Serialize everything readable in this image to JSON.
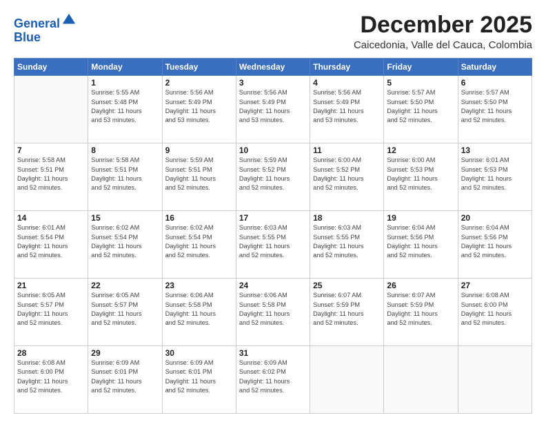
{
  "header": {
    "logo_line1": "General",
    "logo_line2": "Blue",
    "month_title": "December 2025",
    "location": "Caicedonia, Valle del Cauca, Colombia"
  },
  "weekdays": [
    "Sunday",
    "Monday",
    "Tuesday",
    "Wednesday",
    "Thursday",
    "Friday",
    "Saturday"
  ],
  "weeks": [
    [
      {
        "day": "",
        "info": ""
      },
      {
        "day": "1",
        "info": "Sunrise: 5:55 AM\nSunset: 5:48 PM\nDaylight: 11 hours\nand 53 minutes."
      },
      {
        "day": "2",
        "info": "Sunrise: 5:56 AM\nSunset: 5:49 PM\nDaylight: 11 hours\nand 53 minutes."
      },
      {
        "day": "3",
        "info": "Sunrise: 5:56 AM\nSunset: 5:49 PM\nDaylight: 11 hours\nand 53 minutes."
      },
      {
        "day": "4",
        "info": "Sunrise: 5:56 AM\nSunset: 5:49 PM\nDaylight: 11 hours\nand 53 minutes."
      },
      {
        "day": "5",
        "info": "Sunrise: 5:57 AM\nSunset: 5:50 PM\nDaylight: 11 hours\nand 52 minutes."
      },
      {
        "day": "6",
        "info": "Sunrise: 5:57 AM\nSunset: 5:50 PM\nDaylight: 11 hours\nand 52 minutes."
      }
    ],
    [
      {
        "day": "7",
        "info": "Sunrise: 5:58 AM\nSunset: 5:51 PM\nDaylight: 11 hours\nand 52 minutes."
      },
      {
        "day": "8",
        "info": "Sunrise: 5:58 AM\nSunset: 5:51 PM\nDaylight: 11 hours\nand 52 minutes."
      },
      {
        "day": "9",
        "info": "Sunrise: 5:59 AM\nSunset: 5:51 PM\nDaylight: 11 hours\nand 52 minutes."
      },
      {
        "day": "10",
        "info": "Sunrise: 5:59 AM\nSunset: 5:52 PM\nDaylight: 11 hours\nand 52 minutes."
      },
      {
        "day": "11",
        "info": "Sunrise: 6:00 AM\nSunset: 5:52 PM\nDaylight: 11 hours\nand 52 minutes."
      },
      {
        "day": "12",
        "info": "Sunrise: 6:00 AM\nSunset: 5:53 PM\nDaylight: 11 hours\nand 52 minutes."
      },
      {
        "day": "13",
        "info": "Sunrise: 6:01 AM\nSunset: 5:53 PM\nDaylight: 11 hours\nand 52 minutes."
      }
    ],
    [
      {
        "day": "14",
        "info": "Sunrise: 6:01 AM\nSunset: 5:54 PM\nDaylight: 11 hours\nand 52 minutes."
      },
      {
        "day": "15",
        "info": "Sunrise: 6:02 AM\nSunset: 5:54 PM\nDaylight: 11 hours\nand 52 minutes."
      },
      {
        "day": "16",
        "info": "Sunrise: 6:02 AM\nSunset: 5:54 PM\nDaylight: 11 hours\nand 52 minutes."
      },
      {
        "day": "17",
        "info": "Sunrise: 6:03 AM\nSunset: 5:55 PM\nDaylight: 11 hours\nand 52 minutes."
      },
      {
        "day": "18",
        "info": "Sunrise: 6:03 AM\nSunset: 5:55 PM\nDaylight: 11 hours\nand 52 minutes."
      },
      {
        "day": "19",
        "info": "Sunrise: 6:04 AM\nSunset: 5:56 PM\nDaylight: 11 hours\nand 52 minutes."
      },
      {
        "day": "20",
        "info": "Sunrise: 6:04 AM\nSunset: 5:56 PM\nDaylight: 11 hours\nand 52 minutes."
      }
    ],
    [
      {
        "day": "21",
        "info": "Sunrise: 6:05 AM\nSunset: 5:57 PM\nDaylight: 11 hours\nand 52 minutes."
      },
      {
        "day": "22",
        "info": "Sunrise: 6:05 AM\nSunset: 5:57 PM\nDaylight: 11 hours\nand 52 minutes."
      },
      {
        "day": "23",
        "info": "Sunrise: 6:06 AM\nSunset: 5:58 PM\nDaylight: 11 hours\nand 52 minutes."
      },
      {
        "day": "24",
        "info": "Sunrise: 6:06 AM\nSunset: 5:58 PM\nDaylight: 11 hours\nand 52 minutes."
      },
      {
        "day": "25",
        "info": "Sunrise: 6:07 AM\nSunset: 5:59 PM\nDaylight: 11 hours\nand 52 minutes."
      },
      {
        "day": "26",
        "info": "Sunrise: 6:07 AM\nSunset: 5:59 PM\nDaylight: 11 hours\nand 52 minutes."
      },
      {
        "day": "27",
        "info": "Sunrise: 6:08 AM\nSunset: 6:00 PM\nDaylight: 11 hours\nand 52 minutes."
      }
    ],
    [
      {
        "day": "28",
        "info": "Sunrise: 6:08 AM\nSunset: 6:00 PM\nDaylight: 11 hours\nand 52 minutes."
      },
      {
        "day": "29",
        "info": "Sunrise: 6:09 AM\nSunset: 6:01 PM\nDaylight: 11 hours\nand 52 minutes."
      },
      {
        "day": "30",
        "info": "Sunrise: 6:09 AM\nSunset: 6:01 PM\nDaylight: 11 hours\nand 52 minutes."
      },
      {
        "day": "31",
        "info": "Sunrise: 6:09 AM\nSunset: 6:02 PM\nDaylight: 11 hours\nand 52 minutes."
      },
      {
        "day": "",
        "info": ""
      },
      {
        "day": "",
        "info": ""
      },
      {
        "day": "",
        "info": ""
      }
    ]
  ]
}
